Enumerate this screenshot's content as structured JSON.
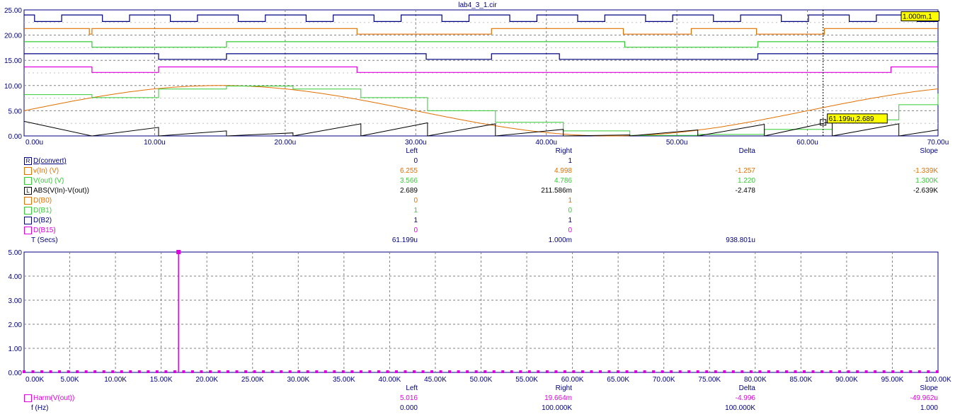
{
  "window_title": "lab4_3_1.cir",
  "colors": {
    "axis": "#000080",
    "grid": "#808080",
    "orange": "#e07000",
    "green": "#33cc33",
    "blue": "#000080",
    "magenta": "#e000e0",
    "black": "#000000"
  },
  "chart_data": [
    {
      "type": "line",
      "x_unit": "s",
      "xlim": [
        0,
        70
      ],
      "ylim": [
        0,
        25
      ],
      "x_ticks": [
        "0.00u",
        "10.00u",
        "20.00u",
        "30.00u",
        "40.00u",
        "50.00u",
        "60.00u",
        "70.00u"
      ],
      "y_ticks": [
        "0.00",
        "5.00",
        "10.00",
        "15.00",
        "20.00",
        "25.00"
      ],
      "cursor_labels": [
        {
          "text": "1.000m,1",
          "x": 70,
          "y": 23.8
        },
        {
          "text": "61.199u,2.689",
          "x": 61.199,
          "y": 2.689
        }
      ],
      "digital_traces": [
        {
          "name": "D(convert)",
          "color": "blue",
          "low": 22.7,
          "high": 24.0,
          "period": 5.2,
          "duty_high": 0.6,
          "offset": 0.8
        },
        {
          "name": "D(B0)",
          "color": "orange",
          "low": 20.2,
          "high": 21.3,
          "edges": [
            [
              0,
              1
            ],
            [
              5.0,
              0
            ],
            [
              5.2,
              1
            ],
            [
              25.5,
              0
            ],
            [
              35.8,
              1
            ],
            [
              45.9,
              0
            ],
            [
              51.1,
              1
            ],
            [
              56.1,
              0
            ],
            [
              61.3,
              1
            ]
          ]
        },
        {
          "name": "D(B1)",
          "color": "green",
          "low": 17.6,
          "high": 18.7,
          "edges": [
            [
              0,
              1
            ],
            [
              5.2,
              0
            ],
            [
              15.5,
              1
            ],
            [
              46.0,
              0
            ],
            [
              56.2,
              1
            ]
          ]
        },
        {
          "name": "D(B2)",
          "color": "blue",
          "low": 15.2,
          "high": 16.3,
          "edges": [
            [
              0,
              1
            ],
            [
              10.3,
              0
            ],
            [
              15.5,
              1
            ],
            [
              30.8,
              0
            ],
            [
              35.8,
              1
            ],
            [
              41.0,
              0
            ],
            [
              56.2,
              1
            ]
          ]
        },
        {
          "name": "D(B15)",
          "color": "magenta",
          "low": 12.6,
          "high": 13.7,
          "edges": [
            [
              0,
              1
            ],
            [
              5.2,
              0
            ],
            [
              10.3,
              1
            ],
            [
              25.5,
              0
            ],
            [
              66.4,
              1
            ]
          ]
        }
      ],
      "analog_traces": [
        {
          "name": "v(In) (V)",
          "color": "orange",
          "kind": "sine",
          "offset": 5.0,
          "amplitude": 5.0,
          "period": 60.0,
          "phase_x": 0
        },
        {
          "name": "V(out) (V)",
          "color": "green",
          "kind": "step",
          "points": [
            [
              0,
              8.2
            ],
            [
              5.2,
              7.6
            ],
            [
              10.3,
              9.3
            ],
            [
              15.5,
              9.9
            ],
            [
              20.6,
              9.3
            ],
            [
              25.8,
              7.6
            ],
            [
              30.9,
              5.0
            ],
            [
              36.1,
              2.7
            ],
            [
              41.3,
              1.0
            ],
            [
              46.4,
              0.1
            ],
            [
              51.6,
              0.3
            ],
            [
              56.7,
              1.3
            ],
            [
              61.9,
              3.2
            ],
            [
              67.0,
              6.2
            ],
            [
              70,
              8.4
            ]
          ]
        },
        {
          "name": "ABS(V(In)-V(out))",
          "color": "black",
          "kind": "sawtooth",
          "points": [
            [
              0,
              2.9
            ],
            [
              5.2,
              0.0
            ],
            [
              10.3,
              1.7
            ],
            [
              10.3,
              0.0
            ],
            [
              15.5,
              1.0
            ],
            [
              15.5,
              0.0
            ],
            [
              20.6,
              0.6
            ],
            [
              20.6,
              0.0
            ],
            [
              25.8,
              2.4
            ],
            [
              25.8,
              0.0
            ],
            [
              30.9,
              2.6
            ],
            [
              30.9,
              0.0
            ],
            [
              36.1,
              2.4
            ],
            [
              36.1,
              0.0
            ],
            [
              41.3,
              1.3
            ],
            [
              41.3,
              0.0
            ],
            [
              46.4,
              0.2
            ],
            [
              46.4,
              0.0
            ],
            [
              51.6,
              1.2
            ],
            [
              51.6,
              0.0
            ],
            [
              56.7,
              2.3
            ],
            [
              56.7,
              0.0
            ],
            [
              61.9,
              2.9
            ],
            [
              61.9,
              0.0
            ],
            [
              67.0,
              2.4
            ],
            [
              67.0,
              0.0
            ],
            [
              70,
              1.2
            ]
          ]
        }
      ]
    },
    {
      "type": "bar",
      "xlim": [
        0,
        100
      ],
      "ylim": [
        0,
        5
      ],
      "x_ticks": [
        "0.00K",
        "5.00K",
        "10.00K",
        "15.00K",
        "20.00K",
        "25.00K",
        "30.00K",
        "35.00K",
        "40.00K",
        "45.00K",
        "50.00K",
        "55.00K",
        "60.00K",
        "65.00K",
        "70.00K",
        "75.00K",
        "80.00K",
        "85.00K",
        "90.00K",
        "95.00K",
        "100.00K"
      ],
      "y_ticks": [
        "0.00",
        "1.00",
        "2.00",
        "3.00",
        "4.00",
        "5.00"
      ],
      "series": [
        {
          "name": "Harm(V(out))",
          "color": "magenta",
          "spike_x": 16.9,
          "spike_y": 5.0,
          "baseline_step": 0.97
        }
      ]
    }
  ],
  "table_top": {
    "headers": [
      "Left",
      "Right",
      "Delta",
      "Slope"
    ],
    "rows": [
      {
        "icon": "R",
        "name": "D(convert)",
        "color": "blue",
        "left": "0",
        "right": "1",
        "delta": "",
        "slope": ""
      },
      {
        "icon": "",
        "name": "v(In) (V)",
        "color": "orange",
        "left": "6.255",
        "right": "4.998",
        "delta": "-1.257",
        "slope": "-1.339K"
      },
      {
        "icon": "",
        "name": "V(out) (V)",
        "color": "green",
        "left": "3.566",
        "right": "4.786",
        "delta": "1.220",
        "slope": "1.300K"
      },
      {
        "icon": "L",
        "name": "ABS(V(In)-V(out))",
        "color": "black",
        "left": "2.689",
        "right": "211.586m",
        "delta": "-2.478",
        "slope": "-2.639K"
      },
      {
        "icon": "",
        "name": "D(B0)",
        "color": "orange",
        "left": "0",
        "right": "1",
        "delta": "",
        "slope": ""
      },
      {
        "icon": "",
        "name": "D(B1)",
        "color": "green",
        "left": "1",
        "right": "0",
        "delta": "",
        "slope": ""
      },
      {
        "icon": "",
        "name": "D(B2)",
        "color": "blue",
        "left": "1",
        "right": "1",
        "delta": "",
        "slope": ""
      },
      {
        "icon": "",
        "name": "D(B15)",
        "color": "magenta",
        "left": "0",
        "right": "0",
        "delta": "",
        "slope": ""
      },
      {
        "icon": "none",
        "name": "T (Secs)",
        "color": "blue",
        "left": "61.199u",
        "right": "1.000m",
        "delta": "938.801u",
        "slope": ""
      }
    ]
  },
  "table_bottom": {
    "headers": [
      "Left",
      "Right",
      "Delta",
      "Slope"
    ],
    "rows": [
      {
        "icon": "",
        "name": "Harm(V(out))",
        "color": "magenta",
        "left": "5.016",
        "right": "19.664m",
        "delta": "-4.996",
        "slope": "-49.962u"
      },
      {
        "icon": "none",
        "name": "f (Hz)",
        "color": "blue",
        "left": "0.000",
        "right": "100.000K",
        "delta": "100.000K",
        "slope": "1.000"
      }
    ]
  }
}
